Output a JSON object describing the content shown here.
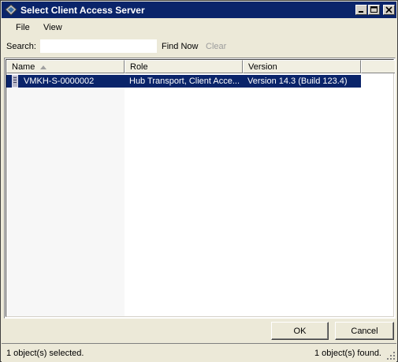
{
  "window": {
    "title": "Select Client Access Server"
  },
  "menu": {
    "items": [
      {
        "label": "File"
      },
      {
        "label": "View"
      }
    ]
  },
  "search": {
    "label": "Search:",
    "value": "",
    "placeholder": "",
    "find_now_label": "Find Now",
    "clear_label": "Clear"
  },
  "list": {
    "columns": [
      {
        "label": "Name",
        "sorted": "ascending"
      },
      {
        "label": "Role"
      },
      {
        "label": "Version"
      }
    ],
    "rows": [
      {
        "name": "VMKH-S-0000002",
        "role": "Hub Transport, Client Acce...",
        "version": "Version 14.3 (Build 123.4)",
        "selected": true,
        "icon": "server-icon"
      }
    ]
  },
  "buttons": {
    "ok_label": "OK",
    "cancel_label": "Cancel"
  },
  "status": {
    "selected_text": "1 object(s) selected.",
    "found_text": "1 object(s) found."
  },
  "colors": {
    "titlebar": "#0a246a",
    "selection": "#0a246a",
    "face": "#ece9d8",
    "disabled_text": "#9d9d9d"
  },
  "icons": {
    "app": "exchange-app-icon",
    "minimize": "minimize-icon",
    "maximize": "maximize-icon",
    "close": "close-icon",
    "sort": "sort-ascending-icon",
    "grip": "resize-grip-icon"
  }
}
